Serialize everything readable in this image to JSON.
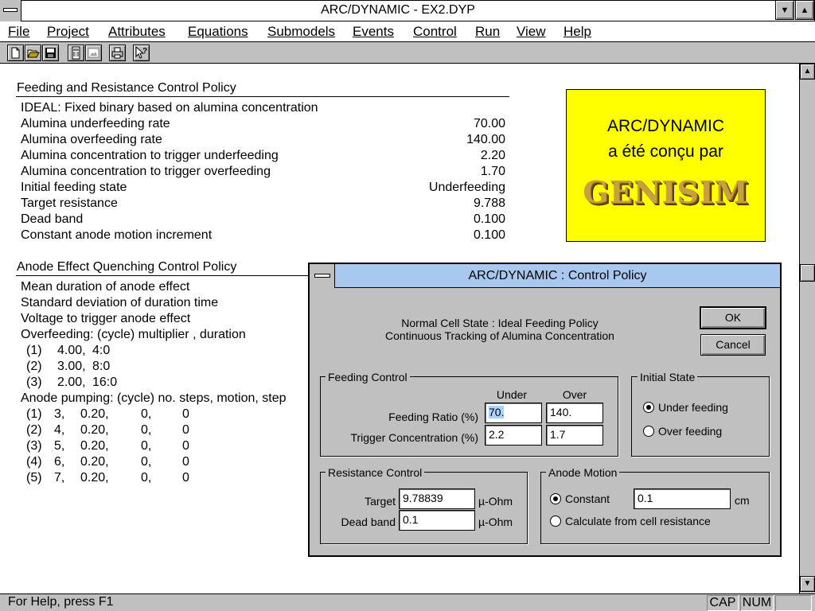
{
  "window": {
    "title": "ARC/DYNAMIC - EX2.DYP",
    "minimize_glyph": "▼",
    "maximize_glyph": "▲"
  },
  "menu": {
    "file": "File",
    "project": "Project",
    "attributes": "Attributes",
    "equations": "Equations",
    "submodels": "Submodels",
    "events": "Events",
    "control": "Control",
    "run": "Run",
    "view": "View",
    "help": "Help"
  },
  "toolbar": {
    "icons": [
      "new-icon",
      "open-icon",
      "save-icon",
      "calculator-icon",
      "picture-icon",
      "print-icon",
      "context-help-icon"
    ]
  },
  "feeding_policy": {
    "title": "Feeding and Resistance Control Policy",
    "rows": [
      {
        "label": "IDEAL: Fixed binary based on alumina concentration",
        "value": ""
      },
      {
        "label": "Alumina underfeeding rate",
        "value": "70.00"
      },
      {
        "label": "Alumina overfeeding rate",
        "value": "140.00"
      },
      {
        "label": "Alumina concentration to trigger underfeeding",
        "value": "2.20"
      },
      {
        "label": "Alumina concentration to trigger overfeeding",
        "value": "1.70"
      },
      {
        "label": "Initial feeding state",
        "value": "Underfeeding"
      },
      {
        "label": "Target resistance",
        "value": "9.788"
      },
      {
        "label": "Dead band",
        "value": "0.100"
      },
      {
        "label": "Constant anode motion increment",
        "value": "0.100"
      }
    ]
  },
  "anode_policy": {
    "title": "Anode Effect Quenching Control Policy",
    "lines": [
      "Mean duration of anode effect",
      "Standard deviation of duration time",
      "Voltage to trigger anode effect",
      "Overfeeding:  (cycle) multiplier , duration"
    ],
    "overfeeding": [
      {
        "n": "(1)",
        "a": "4.00,",
        "b": "4:0"
      },
      {
        "n": "(2)",
        "a": "3.00,",
        "b": "8:0"
      },
      {
        "n": "(3)",
        "a": "2.00,",
        "b": "16:0"
      }
    ],
    "pumping_header": "Anode pumping:  (cycle) no. steps, motion, step",
    "pumping": [
      {
        "n": "(1)",
        "a": "3,",
        "b": "0.20,",
        "c": "0,",
        "d": "0"
      },
      {
        "n": "(2)",
        "a": "4,",
        "b": "0.20,",
        "c": "0,",
        "d": "0"
      },
      {
        "n": "(3)",
        "a": "5,",
        "b": "0.20,",
        "c": "0,",
        "d": "0"
      },
      {
        "n": "(4)",
        "a": "6,",
        "b": "0.20,",
        "c": "0,",
        "d": "0"
      },
      {
        "n": "(5)",
        "a": "7,",
        "b": "0.20,",
        "c": "0,",
        "d": "0"
      }
    ]
  },
  "logo": {
    "line1": "ARC/DYNAMIC",
    "line2": "a été conçu par",
    "brand": "GENISIM"
  },
  "statusbar": {
    "help": "For Help, press F1",
    "cap": "CAP",
    "num": "NUM"
  },
  "dialog": {
    "title": "ARC/DYNAMIC : Control Policy",
    "state_line1": "Normal Cell State : Ideal Feeding Policy",
    "state_line2": "Continuous Tracking of Alumina Concentration",
    "ok": "OK",
    "cancel": "Cancel",
    "feeding": {
      "label": "Feeding Control",
      "col_under": "Under",
      "col_over": "Over",
      "ratio_label": "Feeding Ratio (%)",
      "ratio_under": "70.",
      "ratio_over": "140.",
      "trigger_label": "Trigger Concentration (%)",
      "trigger_under": "2.2",
      "trigger_over": "1.7"
    },
    "initial_state": {
      "label": "Initial State",
      "under": "Under feeding",
      "over": "Over feeding",
      "selected": "under"
    },
    "resistance": {
      "label": "Resistance Control",
      "target_label": "Target",
      "target_value": "9.78839",
      "deadband_label": "Dead band",
      "deadband_value": "0.1",
      "unit": "µ-Ohm"
    },
    "anode_motion": {
      "label": "Anode Motion",
      "constant_label": "Constant",
      "constant_value": "0.1",
      "unit": "cm",
      "calc_label": "Calculate from cell resistance",
      "selected": "constant"
    }
  }
}
